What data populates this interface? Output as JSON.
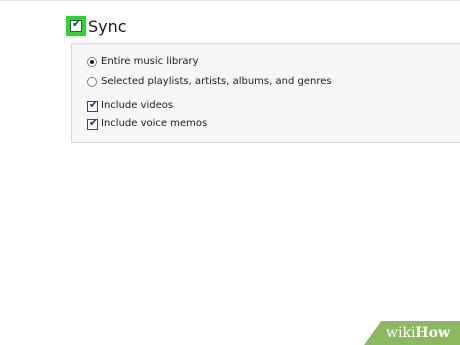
{
  "sync": {
    "label": "Sync",
    "checked": true
  },
  "options": {
    "radios": [
      {
        "label": "Entire music library",
        "selected": true
      },
      {
        "label": "Selected playlists, artists, albums, and genres",
        "selected": false
      }
    ],
    "checkboxes": [
      {
        "label": "Include videos",
        "checked": true
      },
      {
        "label": "Include voice memos",
        "checked": true
      }
    ]
  },
  "icons": {
    "check": "✔"
  },
  "colors": {
    "highlight": "#2bd62b",
    "watermark_bg": "#8cb860"
  },
  "watermark": {
    "wiki": "wiki",
    "how": "How"
  }
}
